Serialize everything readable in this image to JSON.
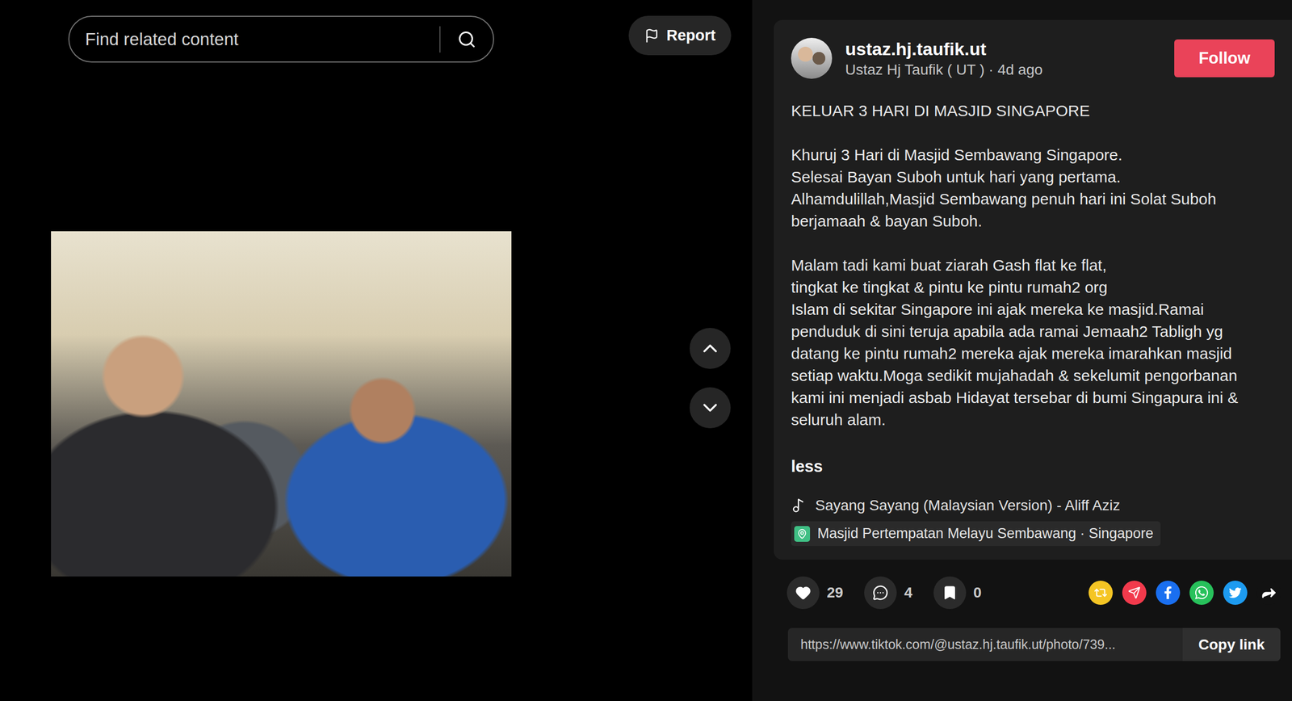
{
  "search": {
    "placeholder": "Find related content"
  },
  "report": {
    "label": "Report"
  },
  "post": {
    "username": "ustaz.hj.taufik.ut",
    "display_name": "Ustaz Hj Taufik ( UT )",
    "separator": "·",
    "time": "4d ago",
    "follow_label": "Follow",
    "description": [
      "KELUAR 3 HARI DI MASJID SINGAPORE",
      "Khuruj 3 Hari di Masjid Sembawang Singapore.\nSelesai Bayan Suboh untuk hari yang pertama.\nAlhamdulillah,Masjid Sembawang penuh hari ini Solat Suboh berjamaah & bayan Suboh.",
      "Malam tadi kami buat ziarah Gash flat ke flat,\ntingkat ke tingkat & pintu ke pintu rumah2 org\nIslam di sekitar Singapore ini ajak mereka ke masjid.Ramai penduduk di sini teruja apabila ada ramai Jemaah2 Tabligh yg datang ke pintu rumah2 mereka ajak mereka imarahkan masjid setiap waktu.Moga sedikit mujahadah & sekelumit pengorbanan kami ini menjadi asbab Hidayat tersebar di bumi Singapura ini & seluruh alam."
    ],
    "toggle": "less",
    "music": "Sayang Sayang (Malaysian Version) - Aliff Aziz",
    "location": "Masjid Pertempatan Melayu Sembawang · Singapore"
  },
  "actions": [
    {
      "kind": "like",
      "count": "29"
    },
    {
      "kind": "comment",
      "count": "4"
    },
    {
      "kind": "save",
      "count": "0"
    }
  ],
  "share_targets": [
    {
      "kind": "repost",
      "color": "#f5c524"
    },
    {
      "kind": "send",
      "color": "#f23a4c"
    },
    {
      "kind": "facebook",
      "color": "#1a6ff0"
    },
    {
      "kind": "whatsapp",
      "color": "#27c15b"
    },
    {
      "kind": "twitter",
      "color": "#1d9bf0"
    },
    {
      "kind": "share",
      "color": "#121212"
    }
  ],
  "link": {
    "url": "https://www.tiktok.com/@ustaz.hj.taufik.ut/photo/739...",
    "button": "Copy link"
  }
}
